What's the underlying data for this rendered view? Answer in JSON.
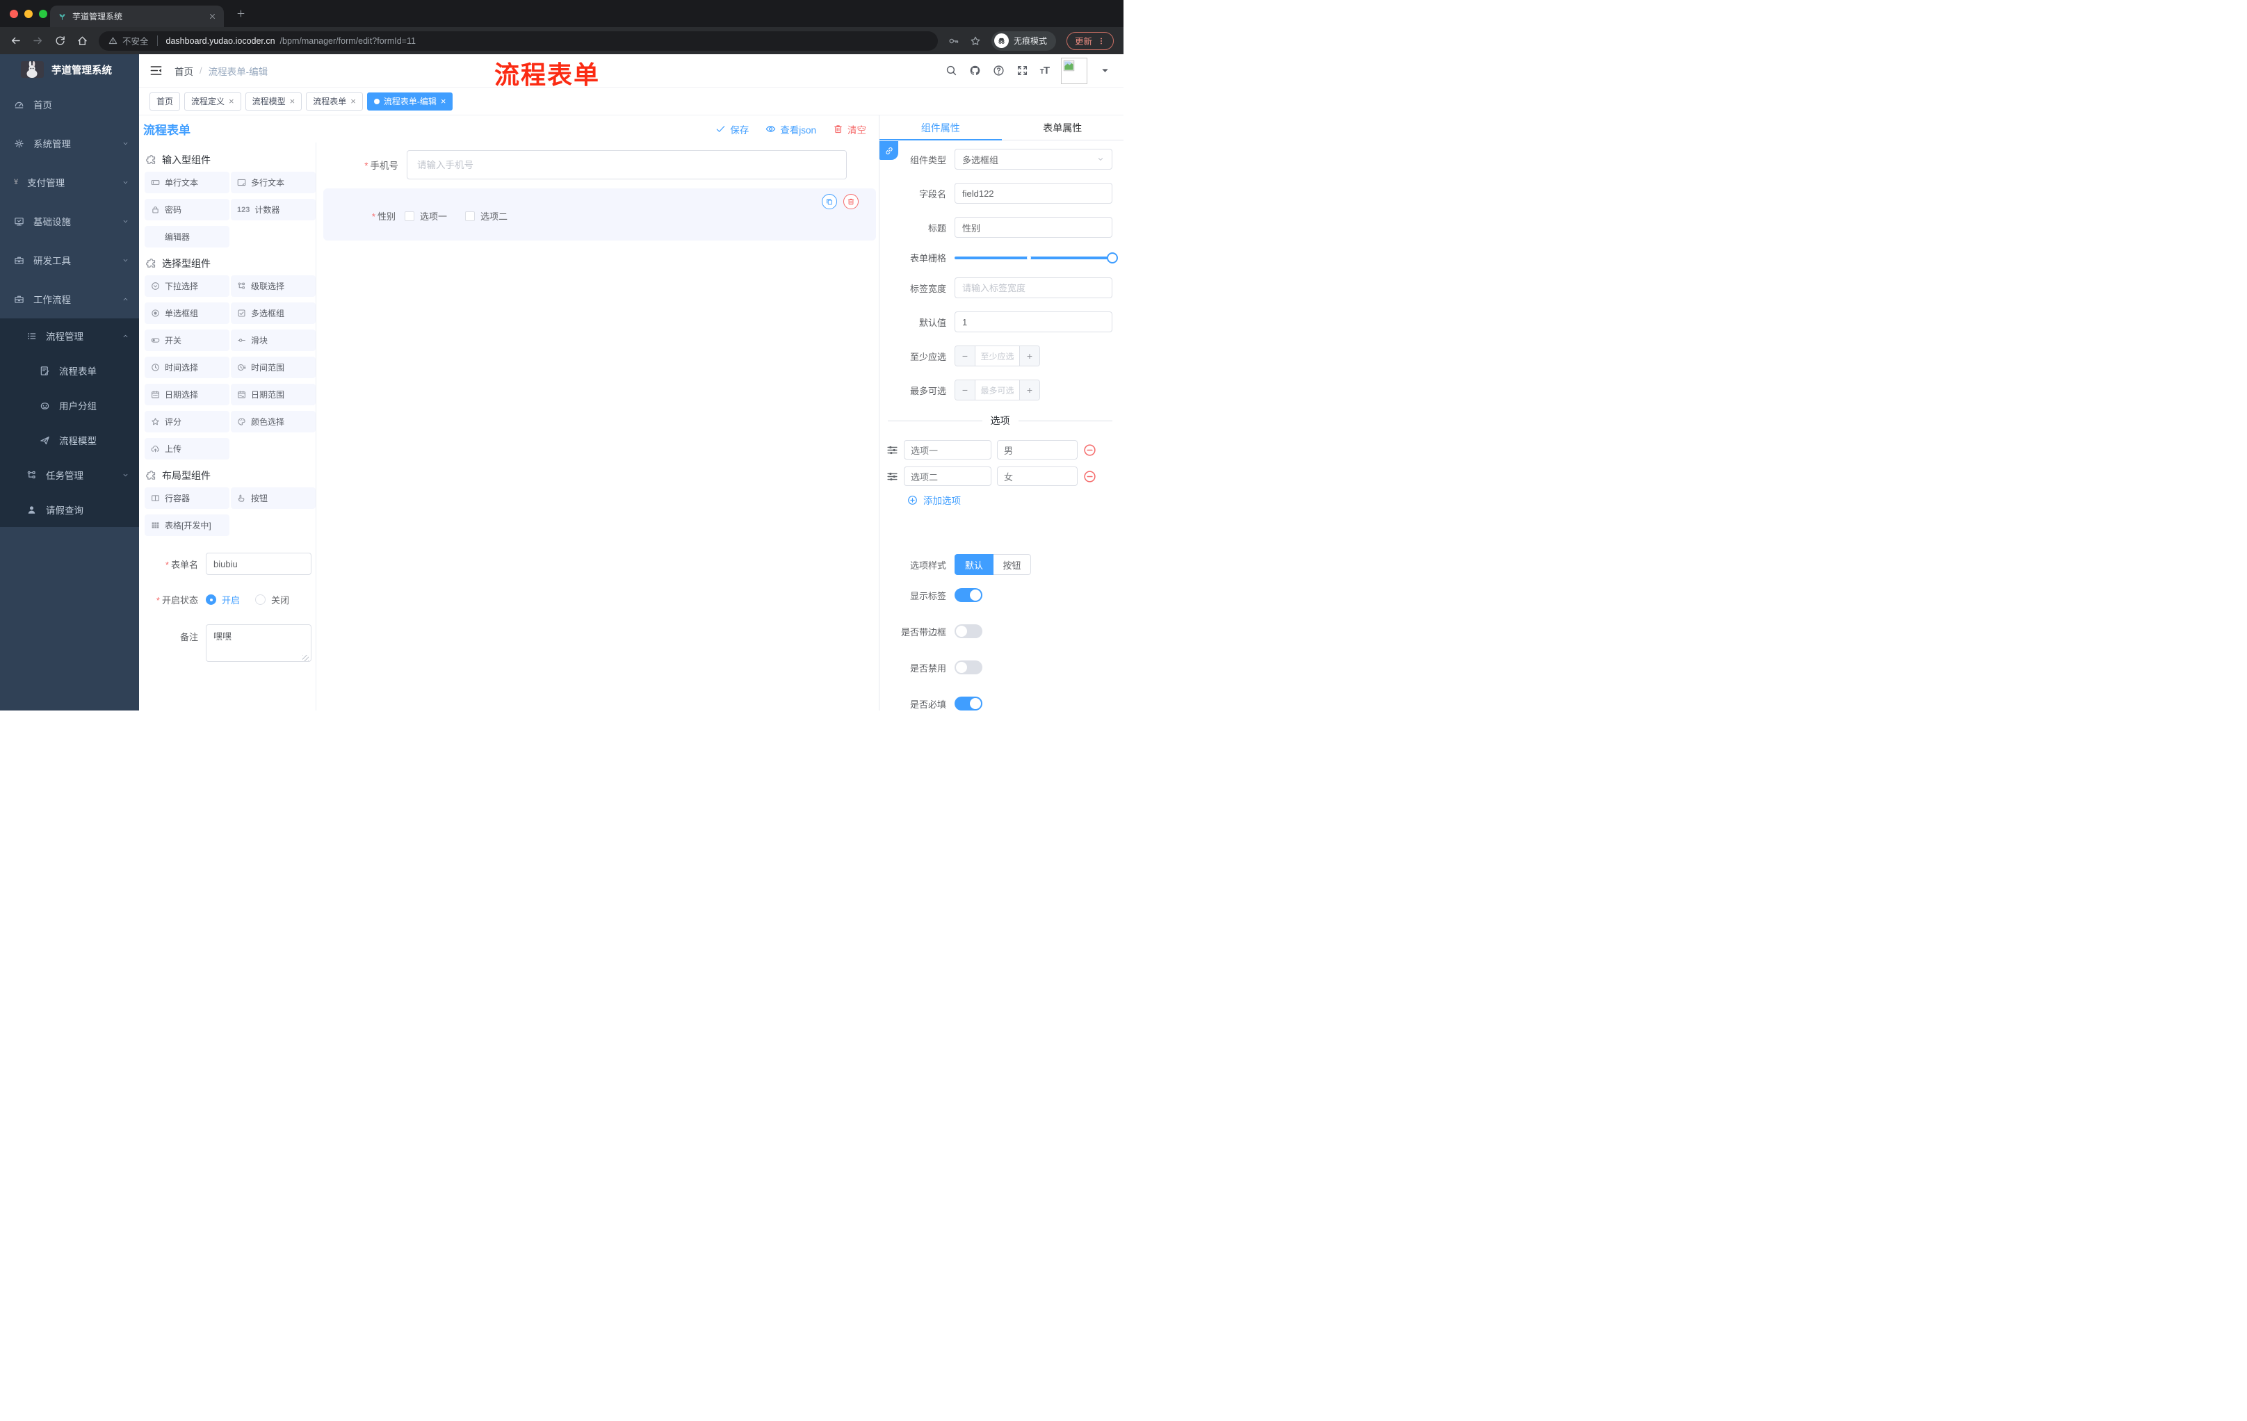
{
  "browser": {
    "tab_title": "芋道管理系统",
    "security_label": "不安全",
    "url_host": "dashboard.yudao.iocoder.cn",
    "url_path": "/bpm/manager/form/edit?formId=11",
    "incognito_label": "无痕模式",
    "update_label": "更新"
  },
  "sidebar": {
    "logo_title": "芋道管理系统",
    "items": [
      {
        "label": "首页",
        "icon": "dashboard",
        "level": 1
      },
      {
        "label": "系统管理",
        "icon": "gear",
        "level": 1,
        "chevron": "down"
      },
      {
        "label": "支付管理",
        "icon": "text:¥",
        "level": 1,
        "chevron": "down"
      },
      {
        "label": "基础设施",
        "icon": "monitor",
        "level": 1,
        "chevron": "down"
      },
      {
        "label": "研发工具",
        "icon": "toolbox",
        "level": 1,
        "chevron": "down"
      },
      {
        "label": "工作流程",
        "icon": "toolbox",
        "level": 1,
        "chevron": "up"
      }
    ],
    "submenu": [
      {
        "label": "流程管理",
        "icon": "list",
        "level": 2,
        "chevron": "up"
      },
      {
        "label": "流程表单",
        "icon": "form-doc",
        "level": 3
      },
      {
        "label": "用户分组",
        "icon": "robot",
        "level": 3
      },
      {
        "label": "流程模型",
        "icon": "plane",
        "level": 3
      },
      {
        "label": "任务管理",
        "icon": "tree",
        "level": 2,
        "chevron": "down"
      },
      {
        "label": "请假查询",
        "icon": "person",
        "level": 2
      }
    ]
  },
  "navbar": {
    "breadcrumb_home": "首页",
    "breadcrumb_sep": "/",
    "breadcrumb_current": "流程表单-编辑",
    "annotation": "流程表单"
  },
  "tagbar": [
    {
      "label": "首页",
      "closable": false,
      "active": false
    },
    {
      "label": "流程定义",
      "closable": true,
      "active": false
    },
    {
      "label": "流程模型",
      "closable": true,
      "active": false
    },
    {
      "label": "流程表单",
      "closable": true,
      "active": false
    },
    {
      "label": "流程表单-编辑",
      "closable": true,
      "active": true
    }
  ],
  "canvas": {
    "title": "流程表单",
    "actions": {
      "save": "保存",
      "view_json": "查看json",
      "clear": "清空"
    },
    "phone_field": {
      "label": "手机号",
      "placeholder": "请输入手机号"
    },
    "gender_field": {
      "label": "性别",
      "options": [
        "选项一",
        "选项二"
      ]
    }
  },
  "components_panel": {
    "sections": [
      {
        "title": "输入型组件",
        "items": [
          {
            "label": "单行文本",
            "icon": "input"
          },
          {
            "label": "多行文本",
            "icon": "textarea"
          },
          {
            "label": "密码",
            "icon": "lock"
          },
          {
            "label": "计数器",
            "icon": "text:123"
          },
          {
            "label": "编辑器",
            "icon": ""
          }
        ]
      },
      {
        "title": "选择型组件",
        "items": [
          {
            "label": "下拉选择",
            "icon": "select"
          },
          {
            "label": "级联选择",
            "icon": "tree"
          },
          {
            "label": "单选框组",
            "icon": "radio"
          },
          {
            "label": "多选框组",
            "icon": "checkbox"
          },
          {
            "label": "开关",
            "icon": "switch"
          },
          {
            "label": "滑块",
            "icon": "slider"
          },
          {
            "label": "时间选择",
            "icon": "clock"
          },
          {
            "label": "时间范围",
            "icon": "clock-range"
          },
          {
            "label": "日期选择",
            "icon": "calendar"
          },
          {
            "label": "日期范围",
            "icon": "calendar-range"
          },
          {
            "label": "评分",
            "icon": "star"
          },
          {
            "label": "颜色选择",
            "icon": "palette"
          },
          {
            "label": "上传",
            "icon": "upload"
          }
        ]
      },
      {
        "title": "布局型组件",
        "items": [
          {
            "label": "行容器",
            "icon": "columns"
          },
          {
            "label": "按钮",
            "icon": "hand"
          },
          {
            "label": "表格[开发中]",
            "icon": "table"
          }
        ]
      }
    ],
    "form": {
      "name_label": "表单名",
      "name_value": "biubiu",
      "status_label": "开启状态",
      "status_on": "开启",
      "status_off": "关闭",
      "remark_label": "备注",
      "remark_value": "嘿嘿"
    }
  },
  "props": {
    "tab_component": "组件属性",
    "tab_form": "表单属性",
    "component_type_label": "组件类型",
    "component_type_value": "多选框组",
    "field_name_label": "字段名",
    "field_name_value": "field122",
    "title_label": "标题",
    "title_value": "性别",
    "grid_label": "表单栅格",
    "label_width_label": "标签宽度",
    "label_width_placeholder": "请输入标签宽度",
    "default_label": "默认值",
    "default_value": "1",
    "min_label": "至少应选",
    "min_placeholder": "至少应选",
    "max_label": "最多可选",
    "max_placeholder": "最多可选",
    "options_title": "选项",
    "options": [
      {
        "label": "选项一",
        "value": "男"
      },
      {
        "label": "选项二",
        "value": "女"
      }
    ],
    "add_option_label": "添加选项",
    "option_style_label": "选项样式",
    "option_style_on": "默认",
    "option_style_off": "按钮",
    "switches": [
      {
        "label": "显示标签",
        "on": true
      },
      {
        "label": "是否带边框",
        "on": false
      },
      {
        "label": "是否禁用",
        "on": false
      },
      {
        "label": "是否必填",
        "on": true
      }
    ],
    "colors": {
      "primary": "#409eff",
      "danger": "#f56c6c"
    }
  }
}
